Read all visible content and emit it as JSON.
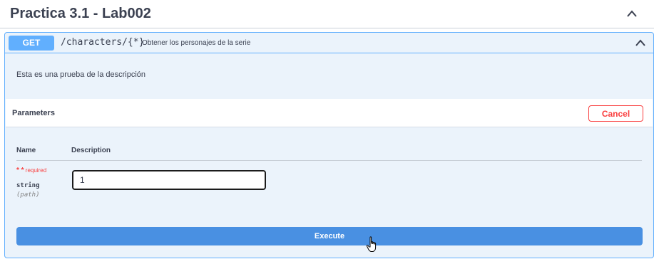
{
  "tag": {
    "title": "Practica 3.1 - Lab002",
    "chevron_icon": "chevron-up-icon"
  },
  "operation": {
    "method": "GET",
    "path": "/characters/{*}",
    "summary": "Obtener los personajes de la serie",
    "description": "Esta es una prueba de la descripción",
    "chevron_icon": "chevron-up-icon",
    "method_color": "#61affe"
  },
  "parameters": {
    "title": "Parameters",
    "cancel_label": "Cancel",
    "columns": {
      "name": "Name",
      "description": "Description"
    },
    "items": [
      {
        "required_marker": "* *",
        "required_label": "required",
        "type": "string",
        "in": "(path)",
        "value": "1"
      }
    ]
  },
  "execute_label": "Execute",
  "colors": {
    "accent": "#4990e2",
    "danger": "#f93e3e",
    "block_bg": "#ebf3fb"
  }
}
